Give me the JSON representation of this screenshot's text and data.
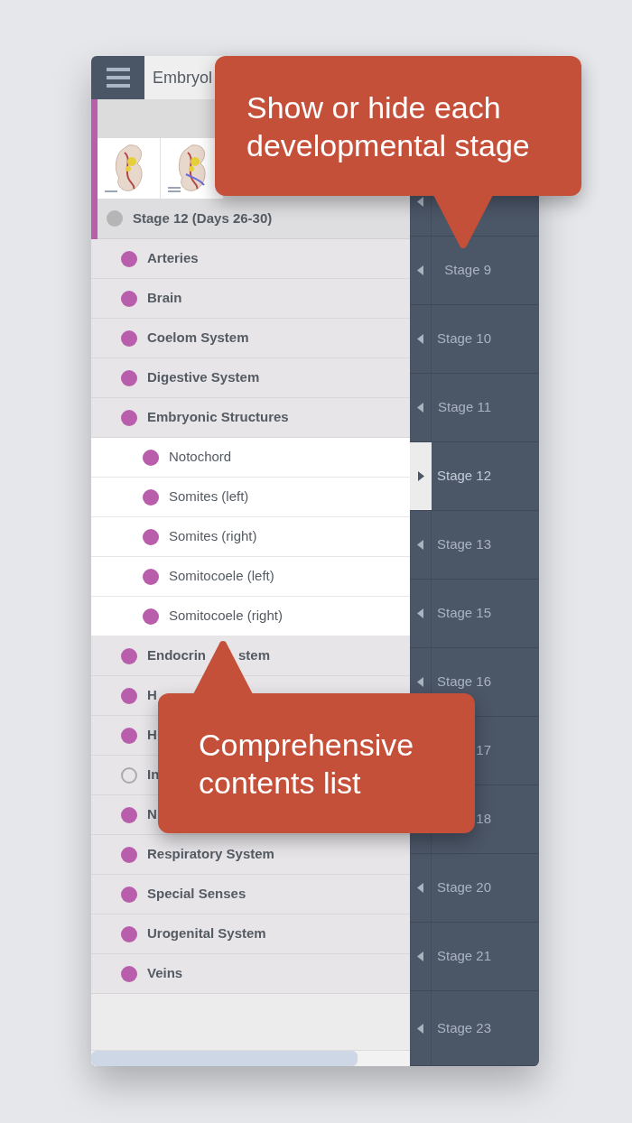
{
  "header": {
    "title": "Embryol"
  },
  "stage_header": {
    "label": "Stage 12 (Days 26-30)",
    "visible": false
  },
  "items": [
    {
      "label": "Arteries",
      "visible": true
    },
    {
      "label": "Brain",
      "visible": true
    },
    {
      "label": "Coelom System",
      "visible": true
    },
    {
      "label": "Digestive System",
      "visible": true
    },
    {
      "label": "Embryonic Structures",
      "visible": true,
      "expanded": true,
      "children": [
        {
          "label": "Notochord",
          "visible": true
        },
        {
          "label": "Somites (left)",
          "visible": true
        },
        {
          "label": "Somites (right)",
          "visible": true
        },
        {
          "label": "Somitocoele (left)",
          "visible": true
        },
        {
          "label": "Somitocoele (right)",
          "visible": true
        }
      ]
    },
    {
      "label": "Endocrin",
      "label_tail": "stem",
      "visible": true
    },
    {
      "label": "H",
      "visible": true
    },
    {
      "label": "H",
      "visible": true
    },
    {
      "label": "In",
      "visible": false
    },
    {
      "label": "N",
      "visible": true
    },
    {
      "label": "Respiratory System",
      "visible": true
    },
    {
      "label": "Special Senses",
      "visible": true
    },
    {
      "label": "Urogenital System",
      "visible": true
    },
    {
      "label": "Veins",
      "visible": true
    }
  ],
  "stages": [
    {
      "selected": false
    },
    {
      "label": "Stage 9",
      "selected": false
    },
    {
      "label": "Stage 10",
      "selected": false
    },
    {
      "label": "Stage 11",
      "selected": false
    },
    {
      "label": "Stage 12",
      "selected": true
    },
    {
      "label": "Stage 13",
      "selected": false
    },
    {
      "label": "Stage 15",
      "selected": false
    },
    {
      "label": "Stage 16",
      "selected": false
    },
    {
      "label": "17",
      "selected": false
    },
    {
      "label": "18",
      "selected": false
    },
    {
      "label": "Stage 20",
      "selected": false
    },
    {
      "label": "Stage 21",
      "selected": false
    },
    {
      "label": "Stage 23",
      "selected": false
    }
  ],
  "callouts": [
    {
      "text": "Show or hide each developmental stage"
    },
    {
      "text": "Comprehensive contents list"
    }
  ]
}
